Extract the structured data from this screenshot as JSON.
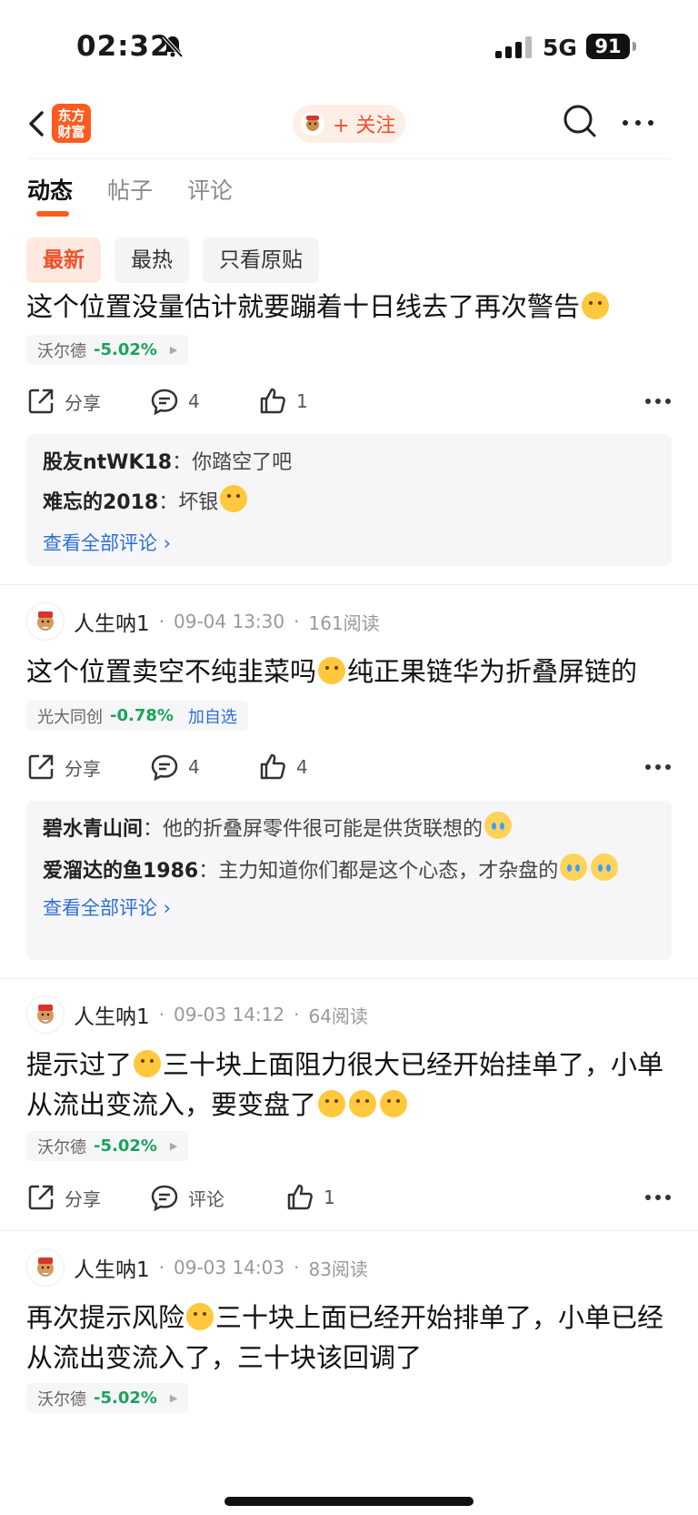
{
  "status_bar": {
    "time": "02:32",
    "network": "5G",
    "battery": "91"
  },
  "nav": {
    "logo_line1": "东方",
    "logo_line2": "财富",
    "follow_label": "+ 关注"
  },
  "tabs": [
    "动态",
    "帖子",
    "评论"
  ],
  "filters": [
    "最新",
    "最热",
    "只看原贴"
  ],
  "posts": [
    {
      "text": "这个位置没量估计就要蹦着十日线去了再次警告",
      "stock": {
        "name": "沃尔德",
        "change": "-5.02%"
      },
      "share_label": "分享",
      "comment_count": "4",
      "like_count": "1",
      "comments": [
        {
          "user": "股友ntWK18",
          "text": "你踏空了吧"
        },
        {
          "user": "难忘的2018",
          "text": "坏银"
        }
      ],
      "view_all": "查看全部评论"
    },
    {
      "author": "人生呐1",
      "time": "09-04 13:30",
      "reads": "161阅读",
      "text_a": "这个位置卖空不纯韭菜吗",
      "text_b": "纯正果链华为折叠屏链的",
      "stock": {
        "name": "光大同创",
        "change": "-0.78%",
        "add": "加自选"
      },
      "share_label": "分享",
      "comment_count": "4",
      "like_count": "4",
      "comments": [
        {
          "user": "碧水青山间",
          "text": "他的折叠屏零件很可能是供货联想的"
        },
        {
          "user": "爱溜达的鱼1986",
          "text": "主力知道你们都是这个心态，才杂盘的"
        }
      ],
      "view_all": "查看全部评论"
    },
    {
      "author": "人生呐1",
      "time": "09-03 14:12",
      "reads": "64阅读",
      "text_a": "提示过了",
      "text_b": "三十块上面阻力很大已经开始挂单了，小单从流出变流入，要变盘了",
      "stock": {
        "name": "沃尔德",
        "change": "-5.02%"
      },
      "share_label": "分享",
      "comment_label": "评论",
      "like_count": "1"
    },
    {
      "author": "人生呐1",
      "time": "09-03 14:03",
      "reads": "83阅读",
      "text_a": "再次提示风险",
      "text_b": "三十块上面已经开始排单了，小单已经从流出变流入了，三十块该回调了",
      "stock": {
        "name": "沃尔德",
        "change": "-5.02%"
      }
    }
  ]
}
